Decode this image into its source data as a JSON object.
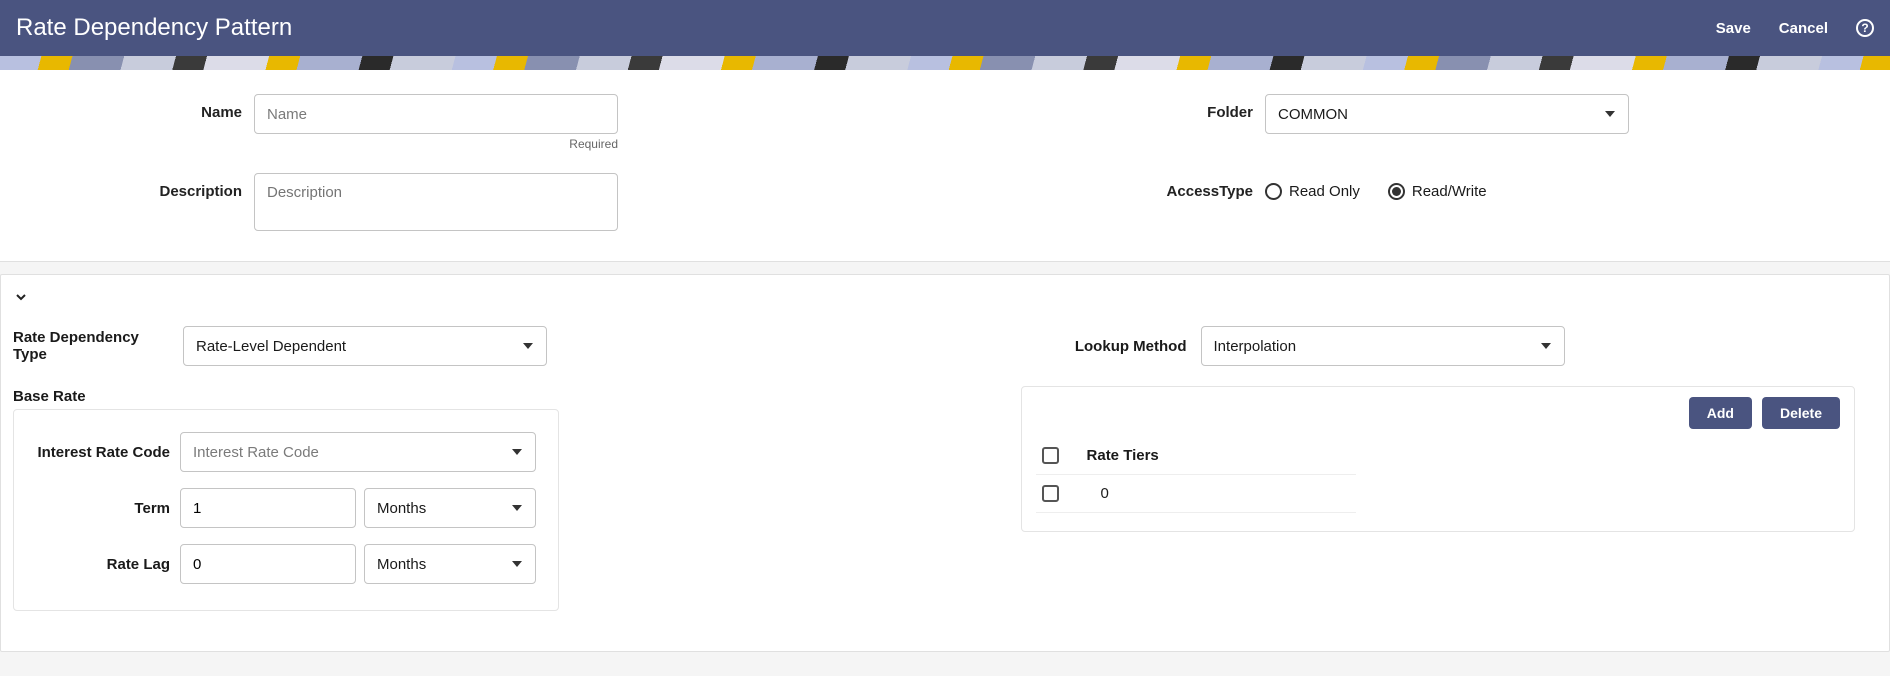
{
  "header": {
    "title": "Rate Dependency Pattern",
    "save_label": "Save",
    "cancel_label": "Cancel",
    "help_icon": "?"
  },
  "topForm": {
    "name": {
      "label": "Name",
      "placeholder": "Name",
      "value": "",
      "hint": "Required"
    },
    "description": {
      "label": "Description",
      "placeholder": "Description",
      "value": ""
    },
    "folder": {
      "label": "Folder",
      "value": "COMMON"
    },
    "accessType": {
      "label": "AccessType",
      "options": [
        {
          "label": "Read Only",
          "selected": false
        },
        {
          "label": "Read/Write",
          "selected": true
        }
      ]
    }
  },
  "mid": {
    "rateDependencyType": {
      "label": "Rate Dependency Type",
      "value": "Rate-Level Dependent"
    },
    "lookupMethod": {
      "label": "Lookup Method",
      "value": "Interpolation"
    },
    "baseRate": {
      "section_label": "Base Rate",
      "interestRateCode": {
        "label": "Interest Rate Code",
        "placeholder": "Interest Rate Code",
        "value": ""
      },
      "term": {
        "label": "Term",
        "value": "1",
        "unit": "Months"
      },
      "rateLag": {
        "label": "Rate Lag",
        "value": "0",
        "unit": "Months"
      }
    },
    "tiers": {
      "add_label": "Add",
      "delete_label": "Delete",
      "column_header": "Rate Tiers",
      "rows": [
        {
          "value": "0"
        }
      ]
    }
  }
}
